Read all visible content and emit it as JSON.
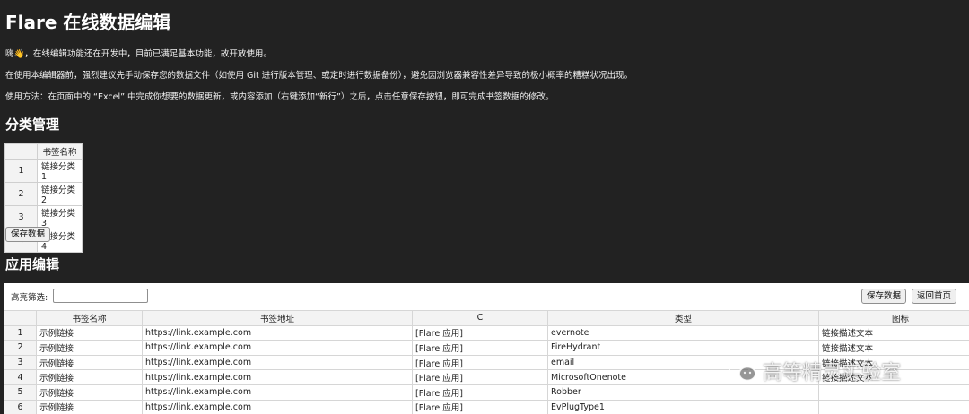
{
  "title": "Flare 在线数据编辑",
  "intro": [
    "嗨👋，在线编辑功能还在开发中，目前已满足基本功能，故开放使用。",
    "在使用本编辑器前，强烈建议先手动保存您的数据文件（如使用 Git 进行版本管理、或定时进行数据备份），避免因浏览器兼容性差异导致的极小概率的糟糕状况出现。",
    "使用方法：在页面中的 “Excel” 中完成你想要的数据更新，或内容添加（右键添加“新行”）之后，点击任意保存按钮，即可完成书签数据的修改。"
  ],
  "category_section": {
    "title": "分类管理",
    "column_header": "书签名称",
    "rows": [
      {
        "index": "1",
        "name": "链接分类1"
      },
      {
        "index": "2",
        "name": "链接分类2"
      },
      {
        "index": "3",
        "name": "链接分类3"
      },
      {
        "index": "4",
        "name": "链接分类4"
      }
    ],
    "save_label": "保存数据"
  },
  "app_section": {
    "title": "应用编辑",
    "filter_label": "高亮筛选:",
    "filter_value": "",
    "save_label": "保存数据",
    "back_label": "返回首页",
    "columns": [
      "",
      "书签名称",
      "书签地址",
      "C",
      "类型",
      "图标"
    ],
    "rows": [
      {
        "index": "1",
        "name": "示例链接",
        "url": "https://link.example.com",
        "c": "[Flare 应用]",
        "type": "evernote",
        "icon": "链接描述文本"
      },
      {
        "index": "2",
        "name": "示例链接",
        "url": "https://link.example.com",
        "c": "[Flare 应用]",
        "type": "FireHydrant",
        "icon": "链接描述文本"
      },
      {
        "index": "3",
        "name": "示例链接",
        "url": "https://link.example.com",
        "c": "[Flare 应用]",
        "type": "email",
        "icon": "链接描述文本"
      },
      {
        "index": "4",
        "name": "示例链接",
        "url": "https://link.example.com",
        "c": "[Flare 应用]",
        "type": "MicrosoftOnenote",
        "icon": "链接描述文本"
      },
      {
        "index": "5",
        "name": "示例链接",
        "url": "https://link.example.com",
        "c": "[Flare 应用]",
        "type": "Robber",
        "icon": ""
      },
      {
        "index": "6",
        "name": "示例链接",
        "url": "https://link.example.com",
        "c": "[Flare 应用]",
        "type": "EvPlugType1",
        "icon": ""
      }
    ]
  },
  "watermark": {
    "text": "高等精灵实验室",
    "icon": "wechat-icon"
  },
  "colors": {
    "background": "#222222",
    "panel": "#ffffff",
    "header_cell": "#f3f3f3"
  }
}
